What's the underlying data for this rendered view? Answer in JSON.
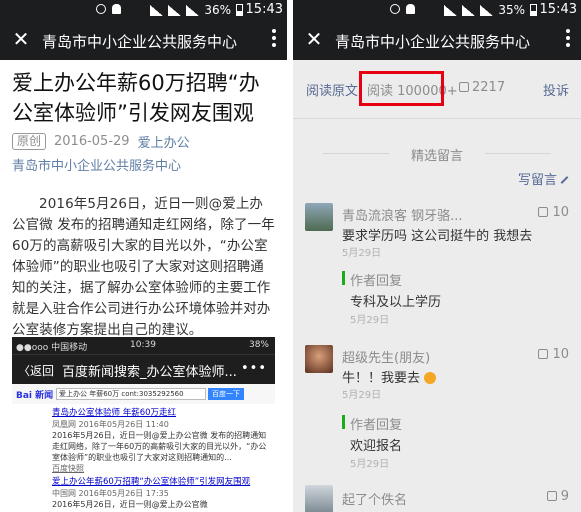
{
  "statusbar": {
    "battery_left": "36%",
    "time_left": "15:43",
    "battery_right": "35%",
    "time_right": "15:43"
  },
  "left": {
    "header": {
      "title": "青岛市中小企业公共服务中心"
    },
    "article": {
      "title": "爱上办公年薪60万招聘“办公室体验师”引发网友围观",
      "tag": "原创",
      "date": "2016-05-29",
      "author": "爱上办公",
      "account": "青岛市中小企业公共服务中心",
      "paragraph": "2016年5月26日，近日一则@爱上办公官微 发布的招聘通知走红网络，除了一年60万的高薪吸引大家的目光以外，“办公室体验师”的职业也吸引了大家对这则招聘通知的关注，据了解办公室体验师的主要工作就是入驻合作公司进行办公环境体验并对办公室装修方案提出自己的建议。"
    },
    "embed": {
      "carrier": "●●ooo 中国移动",
      "time": "10:39",
      "battery": "38%",
      "back": "〈返回",
      "title": "百度新闻搜索_办公室体验师...",
      "more": "•••",
      "logo": "Bai 新闻",
      "query": "爱上办公 年薪60万 cont:3035292560",
      "search_btn": "百度一下",
      "results": [
        {
          "title": "青岛办公室体验师 年薪60万走红",
          "source": "凤凰网  2016年05月26日 11:40",
          "snippet": "2016年5月26日，近日一则@爱上办公官微 发布的招聘通知走红网络，除了一年60万的高薪吸引大家的目光以外，“办公室体验师”的职业也吸引了大家对这则招聘通知的...",
          "snapshot": "百度快照"
        },
        {
          "title": "爱上办公年薪60万招聘“办公室体验师”引发网友围观",
          "source": "中国网  2016年05月26日 17:35",
          "snippet": "2016年5月26日，近日一则@爱上办公官微"
        }
      ]
    }
  },
  "right": {
    "header": {
      "title": "青岛市中小企业公共服务中心"
    },
    "actions": {
      "read_original": "阅读原文",
      "reads": "阅读 100000+",
      "likes": "2217",
      "report": "投诉"
    },
    "selected_heading": "精选留言",
    "write_comment": "写留言",
    "comments": [
      {
        "name": "青岛流浪客 钢牙骆...",
        "likes": "10",
        "text": "要求学历吗 这公司挺牛的 我想去",
        "date": "5月29日",
        "reply_title": "作者回复",
        "reply_text": "专科及以上学历",
        "reply_date": "5月29日"
      },
      {
        "name": "超级先生(朋友)",
        "likes": "10",
        "text": "牛！！我要去",
        "date": "5月29日",
        "reply_title": "作者回复",
        "reply_text": "欢迎报名",
        "reply_date": "5月29日"
      },
      {
        "name": "起了个佚名",
        "likes": "9"
      }
    ]
  },
  "colors": {
    "header_bg": "#1c1d1f",
    "link_blue": "#576b95",
    "account_blue": "#607fa6",
    "highlight_red": "#e60012",
    "reply_green": "#1aad19"
  }
}
